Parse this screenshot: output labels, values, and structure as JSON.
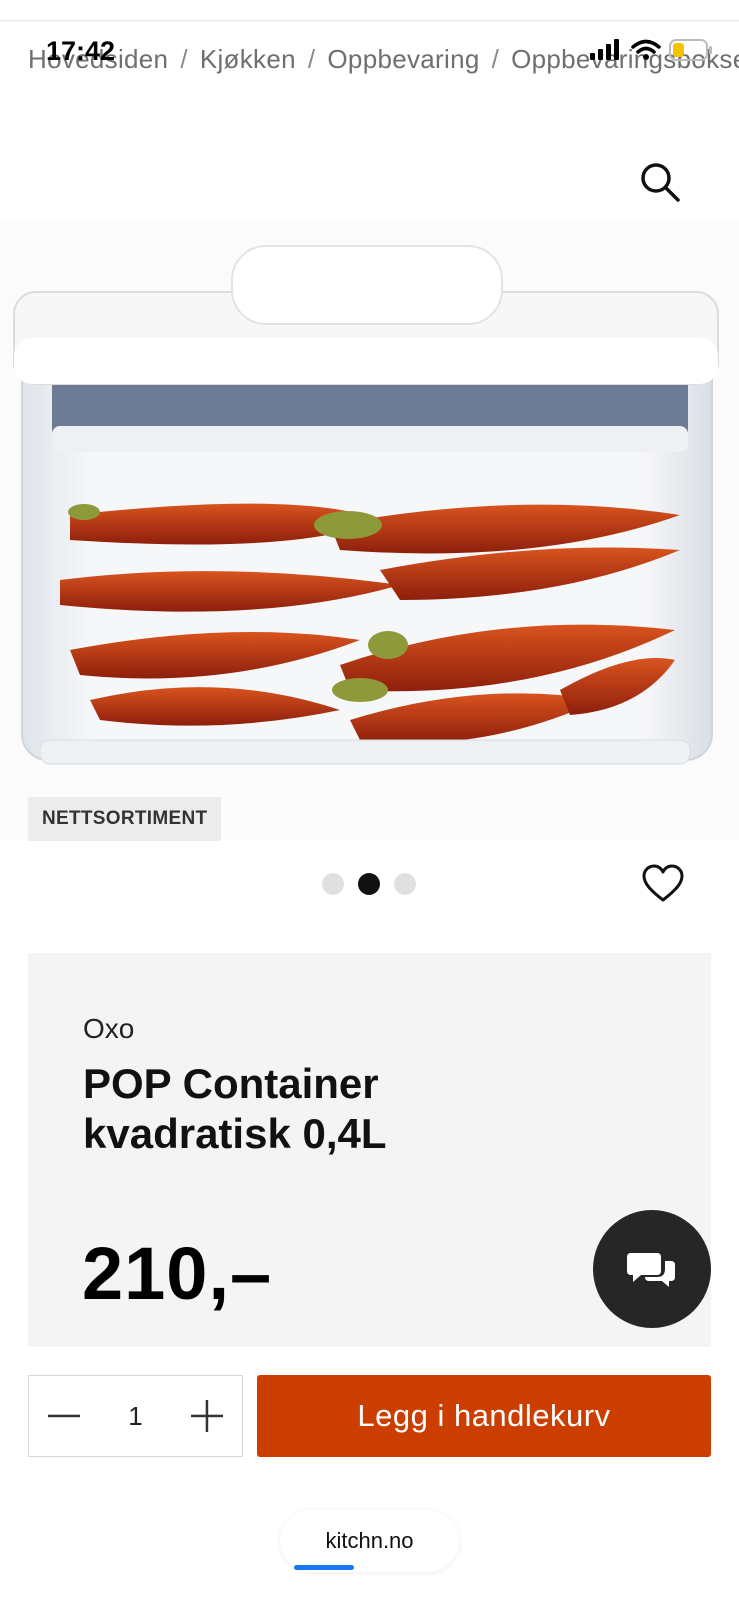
{
  "status_bar": {
    "time": "17:42"
  },
  "breadcrumb": [
    "Hovedsiden",
    "Kjøkken",
    "Oppbevaring",
    "Oppbevaringsbokser"
  ],
  "product": {
    "badge": "NETTSORTIMENT",
    "brand": "Oxo",
    "title": "POP Container kvadratisk 0,4L",
    "price": "210,–",
    "image_count": 3,
    "active_image_index": 1
  },
  "cart": {
    "quantity": "1",
    "add_label": "Legg i handlekurv"
  },
  "browser": {
    "url": "kitchn.no"
  },
  "colors": {
    "accent": "#cc3d00",
    "panel": "#f4f4f4",
    "chat": "#262626",
    "load_bar": "#1877f2"
  },
  "icons": [
    "search-icon",
    "heart-icon",
    "chat-icon",
    "minus-icon",
    "plus-icon",
    "signal-icon",
    "wifi-icon",
    "battery-icon"
  ]
}
